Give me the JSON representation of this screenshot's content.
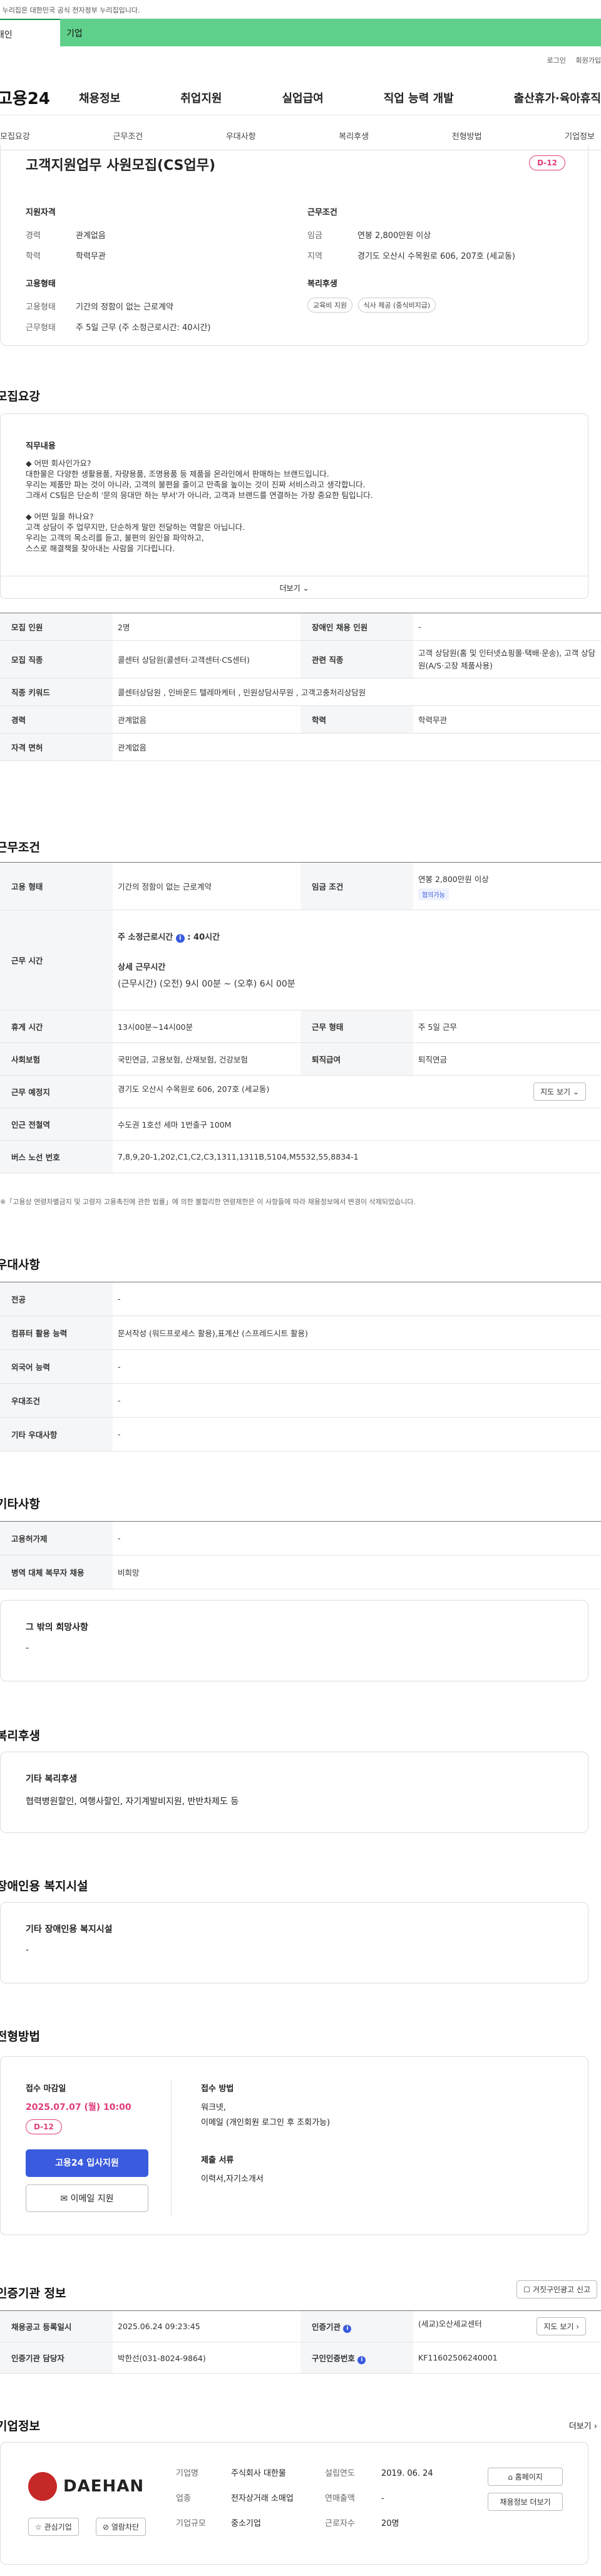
{
  "gov_banner": "이 누리집은 대한민국 공식 전자정부 누리집입니다.",
  "top_tabs": [
    "개인",
    "기업"
  ],
  "util_links": [
    "로그인",
    "회원가입"
  ],
  "logo": "고용24",
  "gnb": [
    "채용정보",
    "취업지원",
    "실업급여",
    "직업 능력 개발",
    "출산휴가·육아휴직"
  ],
  "snb": [
    "모집요강",
    "근무조건",
    "우대사항",
    "복리후생",
    "전형방법",
    "기업정보"
  ],
  "job": {
    "title": "고객지원업무 사원모집(CS업무)",
    "dday": "D-12",
    "qual_h": "지원자격",
    "career_l": "경력",
    "career_v": "관계없음",
    "edu_l": "학력",
    "edu_v": "학력무관",
    "cond_h": "근무조건",
    "wage_l": "임금",
    "wage_v": "연봉 2,800만원 이상",
    "region_l": "지역",
    "region_v": "경기도 오산시 수목원로 606, 207호 (세교동)",
    "emp_h": "고용형태",
    "emptype_l": "고용형태",
    "emptype_v": "기간의 정함이 없는 근로계약",
    "worktype_l": "근무형태",
    "worktype_v": "주 5일 근무 (주 소정근로시간: 40시간)",
    "welfare_h": "복리후생",
    "welfare_tags": [
      "교육비 지원",
      "식사 제공 (중식비지급)"
    ]
  },
  "recruit": {
    "heading": "모집요강",
    "duty_h": "직무내용",
    "duty_lines": [
      "◆ 어떤 회사인가요?",
      "대한물은 다양한 생활용품, 자량용품, 조명용품 등 제품을 온라인에서 판매하는 브랜드입니다.",
      "우리는 제품만 파는 것이 아니라, 고객의 불편을 줄이고 만족을 높이는 것이 진짜 서비스라고 생각합니다.",
      "그래서 CS팀은 단순히 '문의 응대만 하는 부서'가 아니라, 고객과 브랜드를 연결하는 가장 중요한 팀입니다.",
      "",
      "◆ 어떤 일을 하나요?",
      "고객 상담이 주 업무지만, 단순하게 말만 전달하는 역할은 아닙니다.",
      "우리는 고객의 목소리를 듣고, 불편의 원인을 파악하고,",
      "스스로 해결책을 찾아내는 사람을 기다립니다."
    ],
    "more": "더보기",
    "rows": [
      {
        "a": "모집 인원",
        "b": "2명",
        "c": "장애인 채용 인원",
        "d": "-"
      },
      {
        "a": "모집 직종",
        "b": "콜센터 상담원(콜센터·고객센터·CS센터)",
        "c": "관련 직종",
        "d": "고객 상담원(홈 및 인터넷쇼핑몰·택배·운송), 고객 상담원(A/S·고장 제품사용)"
      },
      {
        "a": "직종 키워드",
        "b": "콜센터상담원 , 인바운드 텔레마케터 , 민원상담사무원 , 고객고충처리상담원"
      },
      {
        "a": "경력",
        "b": "관계없음",
        "c": "학력",
        "d": "학력무관"
      },
      {
        "a": "자격 면허",
        "b": "관계없음"
      }
    ]
  },
  "workcond": {
    "heading": "근무조건",
    "emptype_l": "고용 형태",
    "emptype_v": "기간의 정함이 없는 근로계약",
    "wage_l": "임금 조건",
    "wage_v": "연봉 2,800만원 이상",
    "wage_tag": "협의가능",
    "hours_l": "근무 시간",
    "hours_main": "주 소정근로시간",
    "hours_main_v": "40시간",
    "hours_detail_h": "상세 근무시간",
    "hours_detail_v": "(근무시간) (오전) 9시 00분 ~ (오후) 6시 00분",
    "rest_l": "휴게 시간",
    "rest_v": "13시00분~14시00분",
    "form_l": "근무 형태",
    "form_v": "주 5일 근무",
    "ins_l": "사회보험",
    "ins_v": "국민연금, 고용보험, 산재보험, 건강보험",
    "sev_l": "퇴직급여",
    "sev_v": "퇴직연금",
    "place_l": "근무 예정지",
    "place_v": "경기도 오산시 수목원로 606, 207호 (세교동)",
    "map_btn": "지도 보기",
    "subway_l": "인근 전철역",
    "subway_v": "수도권 1호선 세마 1번출구 100M",
    "bus_l": "버스 노선 번호",
    "bus_v": "7,8,9,20-1,202,C1,C2,C3,1311,1311B,5104,M5532,55,8834-1",
    "note": "※「고용상 연령차별금지 및 고령자 고용촉진에 관한 법률」에 의한 불합리한 연령제한은 이 사항들에 따라 채용정보에서 변경이 삭제되었습니다."
  },
  "pref": {
    "heading": "우대사항",
    "rows": [
      {
        "a": "전공",
        "b": "-"
      },
      {
        "a": "컴퓨터 활용 능력",
        "b": "문서작성 (워드프로세스 활용),표계산 (스프레드시트 활용)"
      },
      {
        "a": "외국어 능력",
        "b": "-"
      },
      {
        "a": "우대조건",
        "b": "-"
      },
      {
        "a": "기타 우대사항",
        "b": "-"
      }
    ]
  },
  "etc": {
    "heading": "기타사항",
    "rows": [
      {
        "a": "고용허가제",
        "b": "-"
      },
      {
        "a": "병역 대체 복무자 채용",
        "b": "비희망"
      }
    ],
    "other_h": "그 밖의 희망사항",
    "other_v": "-"
  },
  "welfare": {
    "heading": "복리후생",
    "box_h": "기타 복리후생",
    "box_v": "협력병원할인, 여행사할인, 자기계발비지원, 반반차제도 등"
  },
  "disab": {
    "heading": "장애인용 복지시설",
    "box_h": "기타 장애인용 복지시설",
    "box_v": "-"
  },
  "screening": {
    "heading": "전형방법",
    "deadline_h": "접수 마감일",
    "deadline_v": "2025.07.07 (월) 10:00",
    "dday": "D-12",
    "apply_btn": "고용24 입사지원",
    "email_btn": "이메일 지원",
    "method_h": "접수 방법",
    "method_v1": "워크넷,",
    "method_v2": "이메일 (개인회원 로그인 후 조회가능)",
    "docs_h": "제출 서류",
    "docs_v": "이력서,자기소개서"
  },
  "cert": {
    "heading": "인증기관 정보",
    "report_btn": "거짓구인광고 신고",
    "reg_l": "채용공고 등록일시",
    "reg_v": "2025.06.24 09:23:45",
    "org_l": "인증기관",
    "org_v": "(세교)오산세교센터",
    "map_btn": "지도 보기",
    "mgr_l": "인증기관 담당자",
    "mgr_v": "박한선(031-8024-9864)",
    "no_l": "구인인증번호",
    "no_v": "KF11602506240001"
  },
  "company": {
    "heading": "기업정보",
    "more": "더보기",
    "logo_text": "DAEHAN",
    "interest_btn": "관심기업",
    "block_btn": "열람차단",
    "name_l": "기업명",
    "name_v": "주식회사 대한물",
    "industry_l": "업종",
    "industry_v": "전자상거래 소매업",
    "size_l": "기업규모",
    "size_v": "중소기업",
    "found_l": "설립연도",
    "found_v": "2019. 06. 24",
    "sales_l": "연매출액",
    "sales_v": "-",
    "emp_l": "근로자수",
    "emp_v": "20명",
    "home_btn": "홈페이지",
    "jobs_btn": "채용정보 더보기"
  },
  "colors": {
    "accent": "#3a5bde",
    "pink": "#e03c7c",
    "green": "#5fd08b"
  }
}
